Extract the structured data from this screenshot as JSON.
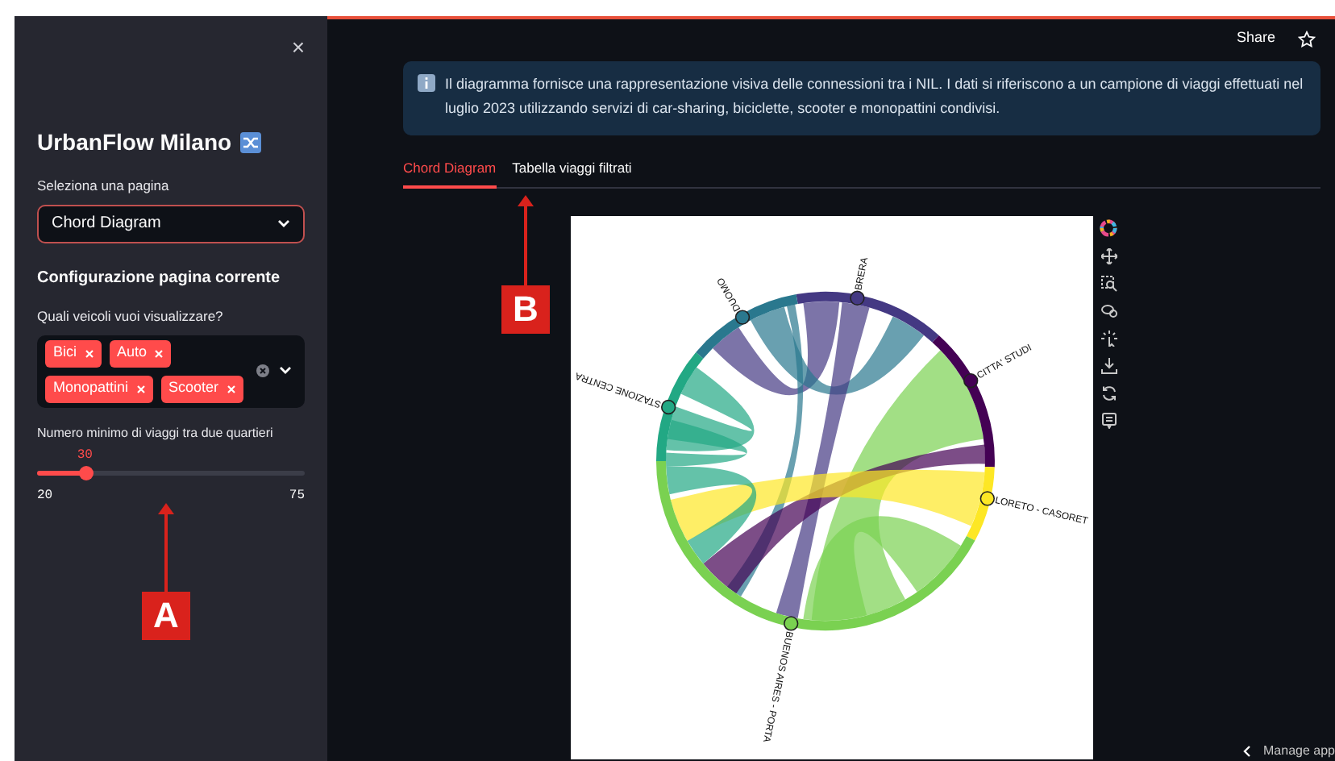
{
  "sidebar": {
    "close": "×",
    "title": "UrbanFlow Milano",
    "page_select": {
      "label": "Seleziona una pagina",
      "value": "Chord Diagram"
    },
    "section_title": "Configurazione pagina corrente",
    "vehicles": {
      "label": "Quali veicoli vuoi visualizzare?",
      "tags": [
        {
          "label": "Bici"
        },
        {
          "label": "Auto"
        },
        {
          "label": "Monopattini"
        },
        {
          "label": "Scooter"
        }
      ]
    },
    "slider": {
      "label": "Numero minimo di viaggi tra due quartieri",
      "value": "30",
      "level": 0.18,
      "min": "20",
      "max": "75"
    }
  },
  "header": {
    "share": "Share"
  },
  "info": "Il diagramma fornisce una rappresentazione visiva delle connessioni tra i NIL. I dati si riferiscono a un campione di viaggi effettuati nel luglio 2023 utilizzando servizi di car-sharing, biciclette, scooter e monopattini condivisi.",
  "tabs": [
    {
      "label": "Chord Diagram",
      "selected": true
    },
    {
      "label": "Tabella viaggi filtrati",
      "selected": false
    }
  ],
  "chord": {
    "nodes": [
      {
        "label": "BRERA",
        "color": "#443983"
      },
      {
        "label": "CITTA' STUDI",
        "color": "#440154"
      },
      {
        "label": "LORETO - CASORET",
        "color": "#fde725"
      },
      {
        "label": "BUENOS AIRES - PORTA",
        "color": "#7ad151"
      },
      {
        "label": "STAZIONE CENTRA",
        "color": "#22a884"
      },
      {
        "label": "DUOMO",
        "color": "#2a788e"
      }
    ]
  },
  "footer": {
    "manage": "Manage app"
  },
  "callouts": [
    {
      "label": "A"
    },
    {
      "label": "B"
    }
  ]
}
